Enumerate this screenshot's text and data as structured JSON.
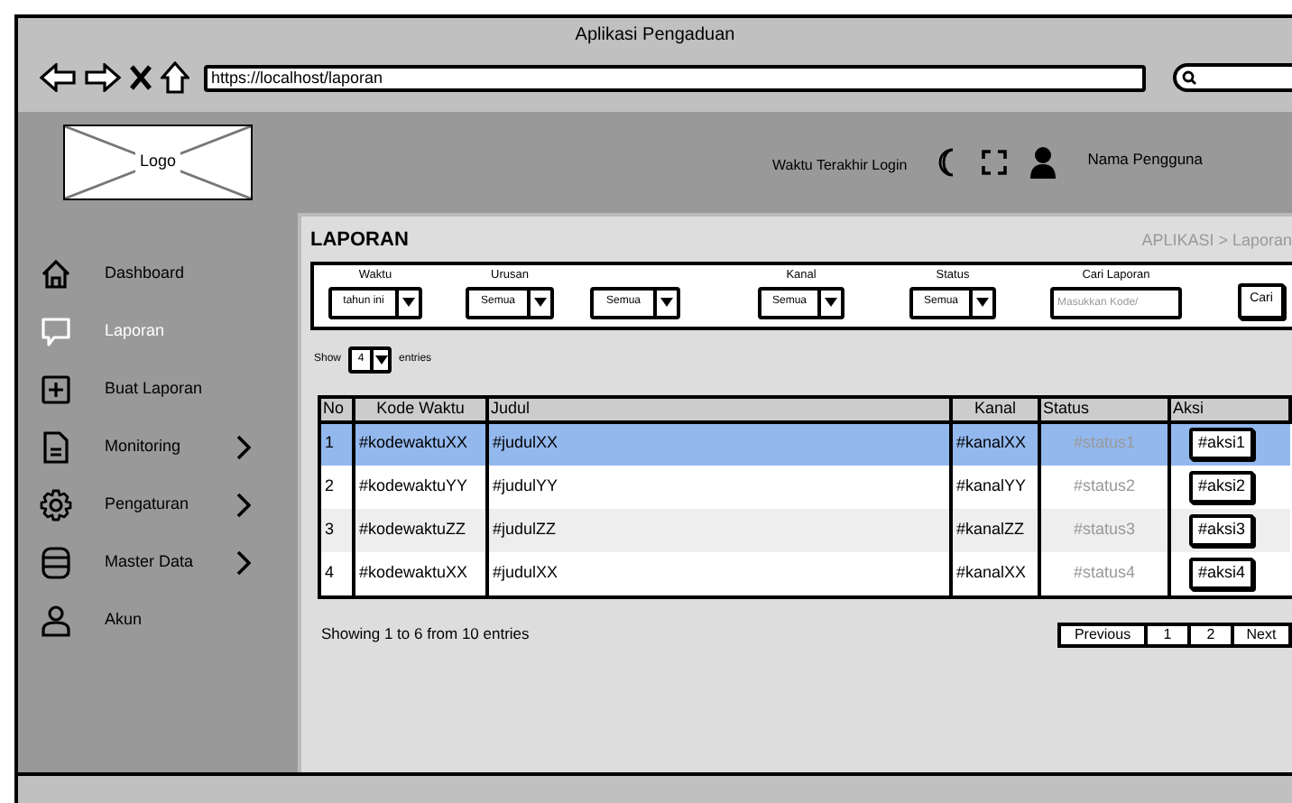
{
  "window": {
    "title": "Aplikasi Pengaduan",
    "url": "https://localhost/laporan"
  },
  "header": {
    "logo": "Logo",
    "last_login": "Waktu Terakhir Login",
    "user_name": "Nama Pengguna"
  },
  "sidebar": {
    "items": [
      {
        "label": "Dashboard",
        "selected": false,
        "has_submenu": false
      },
      {
        "label": "Laporan",
        "selected": true,
        "has_submenu": false
      },
      {
        "label": "Buat Laporan",
        "selected": false,
        "has_submenu": false
      },
      {
        "label": "Monitoring",
        "selected": false,
        "has_submenu": true
      },
      {
        "label": "Pengaturan",
        "selected": false,
        "has_submenu": true
      },
      {
        "label": "Master Data",
        "selected": false,
        "has_submenu": true
      },
      {
        "label": "Akun",
        "selected": false,
        "has_submenu": false
      }
    ]
  },
  "page": {
    "title": "LAPORAN",
    "breadcrumb": "APLIKASI > Laporan"
  },
  "filters": [
    {
      "kind": "select",
      "label": "Waktu",
      "value": "tahun ini"
    },
    {
      "kind": "select",
      "label": "Urusan",
      "value": "Semua"
    },
    {
      "kind": "select",
      "value": "Semua"
    },
    {
      "kind": "select",
      "label": "Kanal",
      "value": "Semua"
    },
    {
      "kind": "select",
      "label": "Status",
      "value": "Semua"
    },
    {
      "kind": "search",
      "label": "Cari Laporan",
      "placeholder": "Masukkan Kode/"
    },
    {
      "kind": "button",
      "label": "Cari"
    }
  ],
  "page_size": {
    "before": "Show",
    "value": "4",
    "after": "entries"
  },
  "table": {
    "columns": [
      "No",
      "Kode Waktu",
      "Judul",
      "Kanal",
      "Status",
      "Aksi"
    ],
    "rows": [
      {
        "cells": [
          "1",
          "#kodewaktuXX",
          "#judulXX",
          "#kanalXX",
          "#status1"
        ],
        "action": "#aksi1",
        "selected": true
      },
      {
        "cells": [
          "2",
          "#kodewaktuYY",
          "#judulYY",
          "#kanalYY",
          "#status2"
        ],
        "action": "#aksi2",
        "selected": false
      },
      {
        "cells": [
          "3",
          "#kodewaktuZZ",
          "#judulZZ",
          "#kanalZZ",
          "#status3"
        ],
        "action": "#aksi3",
        "selected": false
      },
      {
        "cells": [
          "4",
          "#kodewaktuXX",
          "#judulXX",
          "#kanalXX",
          "#status4"
        ],
        "action": "#aksi4",
        "selected": false
      }
    ]
  },
  "footer": {
    "summary": "Showing 1 to 6 from 10 entries",
    "pagination": [
      {
        "label": "Previous"
      },
      {
        "label": "1"
      },
      {
        "label": "2"
      },
      {
        "label": "Next"
      }
    ]
  }
}
